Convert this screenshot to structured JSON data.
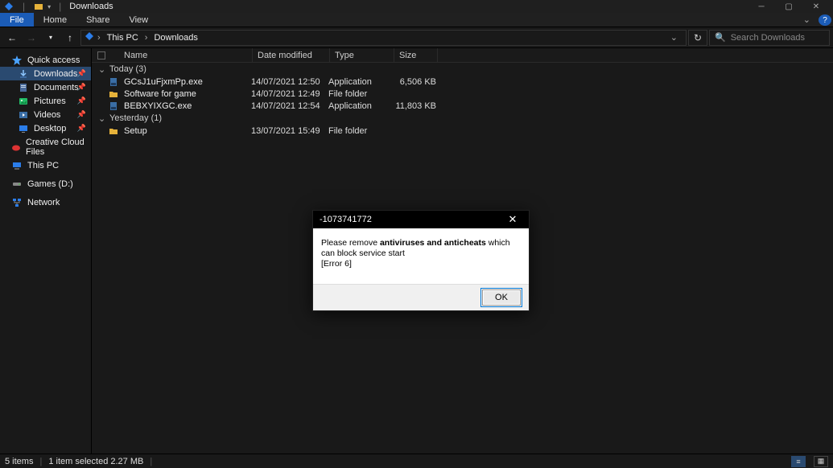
{
  "window": {
    "title": "Downloads"
  },
  "menu": {
    "file": "File",
    "home": "Home",
    "share": "Share",
    "view": "View"
  },
  "nav": {
    "crumb1": "This PC",
    "crumb2": "Downloads",
    "search_placeholder": "Search Downloads"
  },
  "sidebar": {
    "quick": "Quick access",
    "downloads": "Downloads",
    "documents": "Documents",
    "pictures": "Pictures",
    "videos": "Videos",
    "desktop": "Desktop",
    "ccf": "Creative Cloud Files",
    "thispc": "This PC",
    "games": "Games (D:)",
    "network": "Network"
  },
  "columns": {
    "name": "Name",
    "date": "Date modified",
    "type": "Type",
    "size": "Size"
  },
  "groups": [
    {
      "label": "Today (3)"
    },
    {
      "label": "Yesterday (1)"
    }
  ],
  "files_today": [
    {
      "name": "GCsJ1uFjxmPp.exe",
      "date": "14/07/2021 12:50",
      "type": "Application",
      "size": "6,506 KB",
      "icon": "exe"
    },
    {
      "name": "Software for game",
      "date": "14/07/2021 12:49",
      "type": "File folder",
      "size": "",
      "icon": "folder"
    },
    {
      "name": "BEBXYIXGC.exe",
      "date": "14/07/2021 12:54",
      "type": "Application",
      "size": "11,803 KB",
      "icon": "exe"
    }
  ],
  "files_yesterday": [
    {
      "name": "Setup",
      "date": "13/07/2021 15:49",
      "type": "File folder",
      "size": "",
      "icon": "folder"
    }
  ],
  "status": {
    "items": "5 items",
    "selected": "1 item selected  2.27 MB"
  },
  "dialog": {
    "title": "-1073741772",
    "body_line1_pre": "Please remove ",
    "body_line1_bold": "antiviruses and anticheats",
    "body_line1_post": " which can block service start",
    "body_line2": "[Error 6]",
    "ok": "OK"
  },
  "icons": {
    "help": "?"
  }
}
